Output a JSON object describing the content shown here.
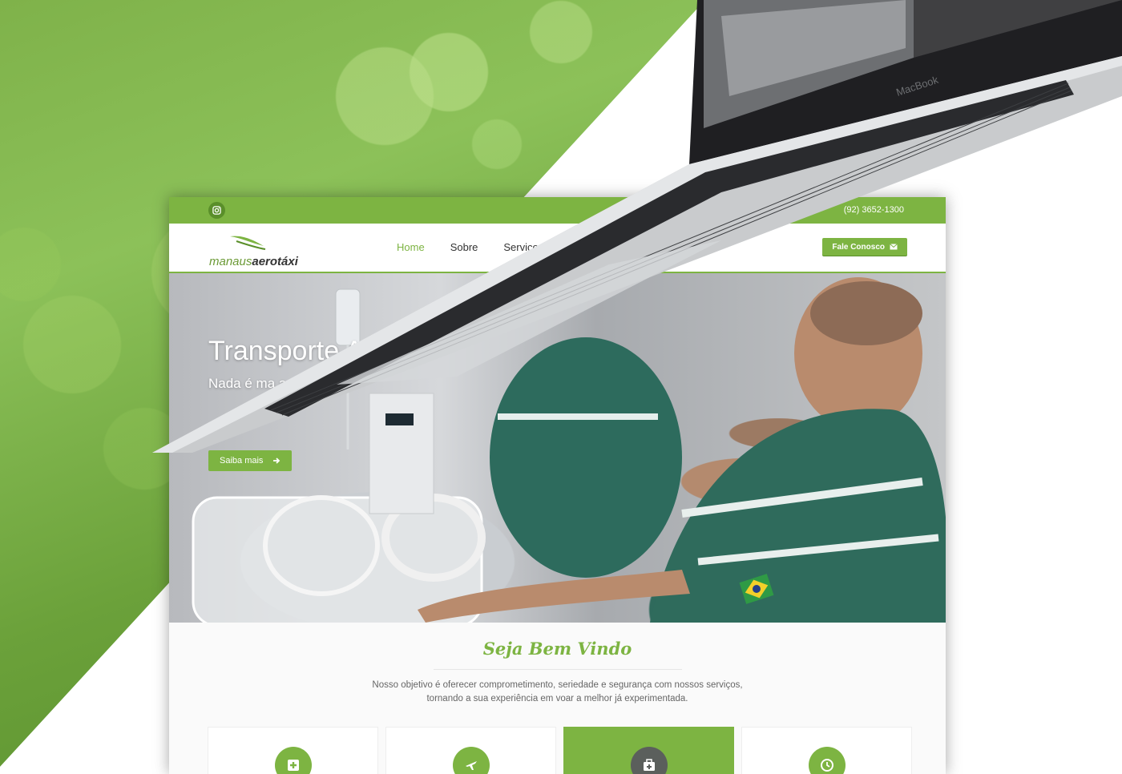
{
  "topbar": {
    "phone": "(92) 3652-1300"
  },
  "brand": {
    "logo_part1": "manaus",
    "logo_part2": "aerotáxi"
  },
  "nav": {
    "items": [
      {
        "label": "Home"
      },
      {
        "label": "Sobre"
      },
      {
        "label": "Serviços"
      }
    ],
    "cta_label": "Fale Conosco"
  },
  "hero": {
    "title": "Transporte A",
    "subtitle": "Nada é ma                                    a vida",
    "button_label": "Saiba mais"
  },
  "welcome": {
    "title": "Seja Bem Vindo",
    "text_line1": "Nosso objetivo é oferecer comprometimento, seriedade e segurança com nossos serviços,",
    "text_line2": "tornando a sua experiência em voar a melhor já experimentada."
  },
  "laptop": {
    "brand_label": "MacBook"
  },
  "colors": {
    "accent": "#7db442",
    "dark_accent": "#5a8f2a",
    "text": "#333333"
  },
  "icons": [
    "instagram-icon",
    "envelope-icon",
    "arrow-right-icon",
    "medical-plus-icon",
    "airplane-icon",
    "medkit-icon",
    "clock-icon"
  ]
}
